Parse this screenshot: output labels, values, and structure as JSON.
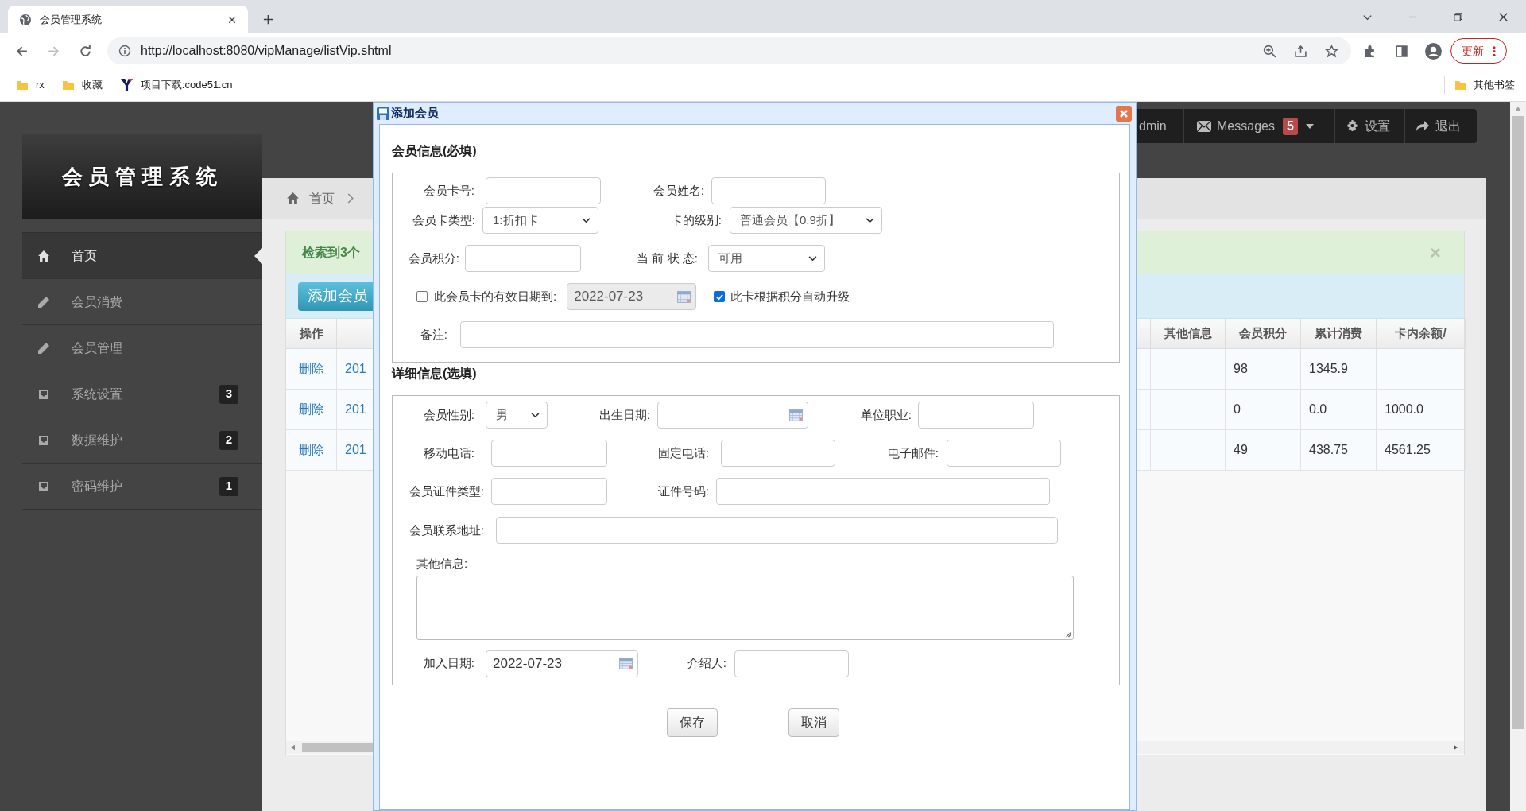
{
  "browser": {
    "tab_title": "会员管理系统",
    "url": "http://localhost:8080/vipManage/listVip.shtml",
    "update_button": "更新",
    "bookmarks": [
      {
        "label": "rx",
        "kind": "folder"
      },
      {
        "label": "收藏",
        "kind": "folder"
      },
      {
        "label": "项目下载:code51.cn",
        "kind": "site"
      }
    ],
    "other_bookmarks": "其他书签"
  },
  "app": {
    "title": "会员管理系统",
    "navbar": {
      "user": "dmin",
      "messages": "Messages",
      "message_count": "5",
      "settings": "设置",
      "logout": "退出"
    },
    "sidebar": [
      {
        "label": "首页",
        "kind": "home",
        "selected": true
      },
      {
        "label": "会员消费",
        "kind": "edit",
        "selected": false
      },
      {
        "label": "会员管理",
        "kind": "edit",
        "selected": false
      },
      {
        "label": "系统设置",
        "kind": "tray",
        "selected": false,
        "count": "3"
      },
      {
        "label": "数据维护",
        "kind": "tray",
        "selected": false,
        "count": "2"
      },
      {
        "label": "密码维护",
        "kind": "tray",
        "selected": false,
        "count": "1"
      }
    ],
    "breadcrumb": "首页",
    "alert": "检索到3个",
    "add_button": "添加会员",
    "table": {
      "columns": [
        "操作",
        "其他信息",
        "会员积分",
        "累计消费",
        "卡内余额/"
      ],
      "rows": [
        {
          "action": "删除",
          "column_2": "201",
          "points": "98",
          "total_spent": "1345.9"
        },
        {
          "action": "删除",
          "column_2": "201",
          "points": "0",
          "total_spent": "0.0",
          "balance": "1000.0"
        },
        {
          "action": "删除",
          "column_2": "201",
          "points": "49",
          "total_spent": "438.75",
          "balance": "4561.25"
        }
      ]
    }
  },
  "dialog": {
    "title": "添加会员",
    "sections": [
      {
        "title": "会员信息(必填)",
        "rows": [
          [
            {
              "label": "会员卡号:",
              "kind": "text"
            },
            {
              "label": "会员姓名:",
              "kind": "text"
            }
          ],
          [
            {
              "label": "会员卡类型:",
              "kind": "select",
              "value": "1:折扣卡"
            },
            {
              "label": "卡的级别:",
              "kind": "select",
              "value": "普通会员【0.9折】"
            }
          ],
          [
            {
              "label": "会员积分:",
              "kind": "text"
            },
            {
              "label": "当 前 状 态:",
              "kind": "select",
              "value": "可用"
            }
          ],
          [
            {
              "label": "此会员卡的有效日期到:",
              "kind": "checkbox",
              "checked": false
            },
            {
              "kind": "date",
              "value": "2022-07-23",
              "disabled": true
            },
            {
              "label": "此卡根据积分自动升级",
              "kind": "checkbox",
              "checked": true
            }
          ],
          [
            {
              "label": "备注:",
              "kind": "text"
            }
          ]
        ]
      },
      {
        "title": "详细信息(选填)",
        "rows": [
          [
            {
              "label": "会员性别:",
              "kind": "select",
              "value": "男"
            },
            {
              "label": "出生日期:",
              "kind": "date",
              "disabled": false
            },
            {
              "label": "单位职业:",
              "kind": "text"
            }
          ],
          [
            {
              "label": "移动电话:",
              "kind": "text"
            },
            {
              "label": "固定电话:",
              "kind": "text"
            },
            {
              "label": "电子邮件:",
              "kind": "text"
            }
          ],
          [
            {
              "label": "会员证件类型:",
              "kind": "text"
            },
            {
              "label": "证件号码:",
              "kind": "text"
            }
          ],
          [
            {
              "label": "会员联系地址:",
              "kind": "text"
            }
          ],
          [
            {
              "label": "其他信息:",
              "kind": "textarea"
            }
          ],
          [
            {
              "label": "加入日期:",
              "kind": "date",
              "value": "2022-07-23",
              "disabled": false
            },
            {
              "label": "介绍人:",
              "kind": "text"
            }
          ]
        ]
      }
    ],
    "buttons": [
      "保存",
      "取消"
    ]
  }
}
